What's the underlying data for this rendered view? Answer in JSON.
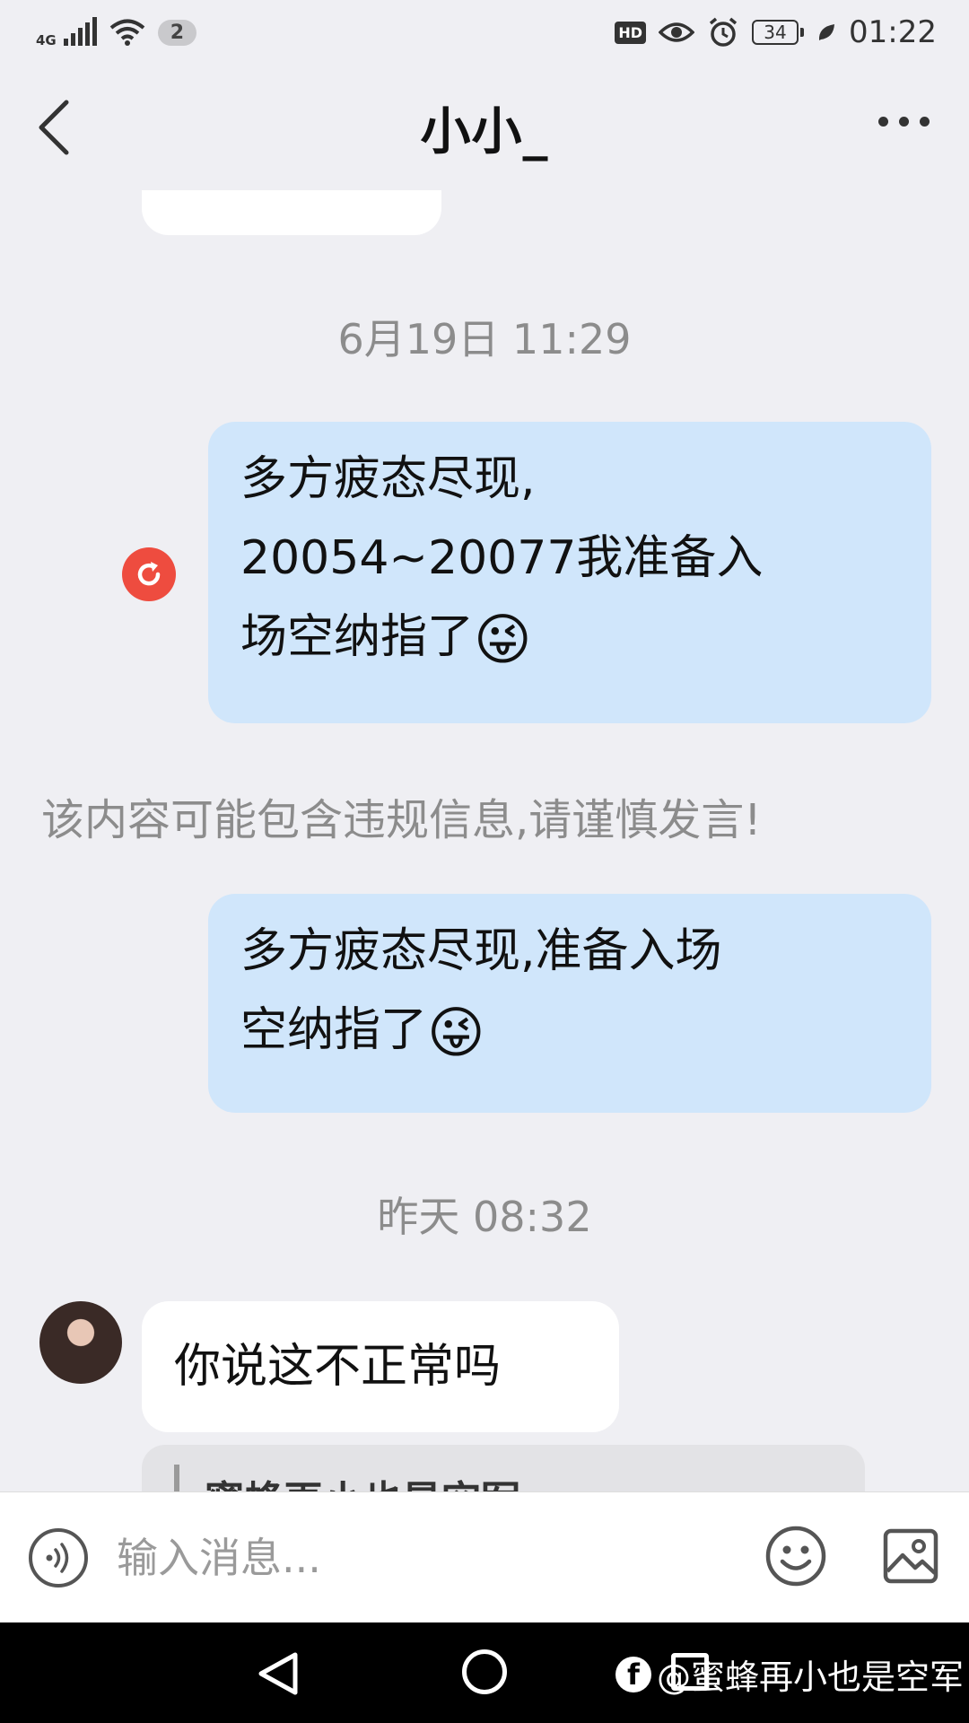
{
  "status_bar": {
    "network": "4G",
    "notification_count": "2",
    "hd": "HD",
    "battery": "34",
    "time": "01:22",
    "icons": [
      "signal-icon",
      "wifi-icon",
      "eye-icon",
      "alarm-icon",
      "battery-icon",
      "leaf-icon"
    ]
  },
  "header": {
    "title": "小小_",
    "icons": [
      "back-arrow-icon",
      "more-icon"
    ]
  },
  "messages": {
    "timestamp_1": "6月19日 11:29",
    "out_1_line1": "多方疲态尽现,",
    "out_1_line2": "20054~20077我准备入",
    "out_1_line3": "场空纳指了",
    "emoji": "😜",
    "warning": "该内容可能包含违规信息,请谨慎发言!",
    "out_2_line1": "多方疲态尽现,准备入场",
    "out_2_line2": "空纳指了",
    "timestamp_2": "昨天 08:32",
    "in_1": "你说这不正常吗",
    "quote_partial": "蜜蜂再小也是空军:"
  },
  "input_bar": {
    "placeholder": "输入消息...",
    "icons": [
      "voice-icon",
      "emoji-icon",
      "image-icon"
    ]
  },
  "nav_bar": {
    "watermark": "@蜜蜂再小也是空军",
    "icons": [
      "nav-back-icon",
      "nav-home-icon",
      "nav-recent-icon",
      "facebook-icon"
    ]
  },
  "colors": {
    "background": "#efeff3",
    "outgoing_bubble": "#d0e6fb",
    "incoming_bubble": "#ffffff",
    "resend_red": "#ee4c3f",
    "muted_text": "#8c8c8c"
  }
}
